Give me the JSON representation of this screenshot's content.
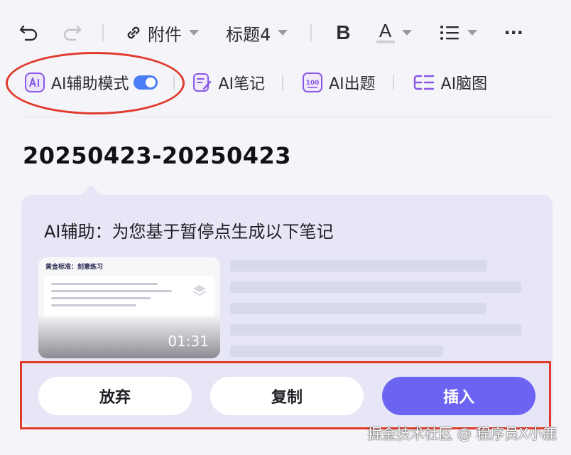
{
  "toolbar": {
    "attachment_label": "附件",
    "heading_label": "标题4",
    "bold_label": "B",
    "font_color_label": "A",
    "more_label": "···"
  },
  "ai_toolbar": {
    "assist_mode_label": "AI辅助模式",
    "assist_mode_on": true,
    "notes_label": "AI笔记",
    "quiz_label": "AI出题",
    "mindmap_label": "AI脑图"
  },
  "document": {
    "title": "20250423-20250423"
  },
  "ai_panel": {
    "heading": "AI辅助：为您基于暂停点生成以下笔记",
    "thumbnail": {
      "title": "黄金标准：刻意练习",
      "timestamp": "01:31"
    },
    "buttons": {
      "discard": "放弃",
      "copy": "复制",
      "insert": "插入"
    }
  },
  "watermark": "掘金技术社区 @ 程序员X小鹿",
  "colors": {
    "accent": "#6d63f2",
    "toggle": "#4a7cf6",
    "highlight": "#e03a2c",
    "panel": "#e6e6f6"
  }
}
